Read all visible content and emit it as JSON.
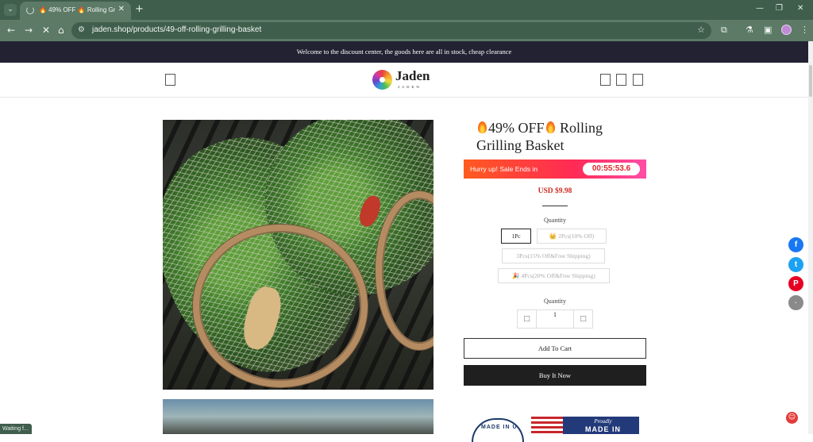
{
  "browser": {
    "tab_title": "🔥 49% OFF 🔥 Rolling Grilling Basket",
    "tab_close": "✕",
    "new_tab": "+",
    "url": "jaden.shop/products/49-off-rolling-grilling-basket",
    "status": "Waiting f..."
  },
  "announcement": "Welcome to the discount center, the goods here are all in stock, cheap clearance",
  "logo": {
    "brand": "Jaden",
    "sub": "JADEN"
  },
  "product": {
    "title_part1": "49% OFF",
    "title_part2": "Rolling Grilling Basket",
    "countdown_label": "Hurry up! Sale Ends in",
    "countdown_timer": "00:55:53.6",
    "price": "USD $9.98",
    "quantity_label": "Quantity",
    "options": [
      {
        "label": "1Pc"
      },
      {
        "label": "👑 2Pcs(10% Off)"
      },
      {
        "label": "3Pcs(15% Off&Free Shipping)"
      },
      {
        "label": "🎉 4Pcs(20% Off&Free Shipping)"
      }
    ],
    "qty_label": "Quantity",
    "qty_value": "1",
    "qty_minus": "□",
    "qty_plus": "□",
    "add_to_cart": "Add To Cart",
    "buy_now": "Buy It Now",
    "badge_seal_text": "MADE IN US",
    "badge_flag_text": "Proudly",
    "badge_flag_text2": "MADE IN"
  },
  "social": {
    "facebook": "f",
    "twitter": "t",
    "pinterest": "P",
    "share": "·"
  },
  "colors": {
    "chrome": "#3f5e4b",
    "announce_bg": "#222233",
    "price": "#cc2a20",
    "buy_bg": "#1f1f1f",
    "countdown_from": "#ff5a1f",
    "countdown_to": "#ff4ea6"
  }
}
